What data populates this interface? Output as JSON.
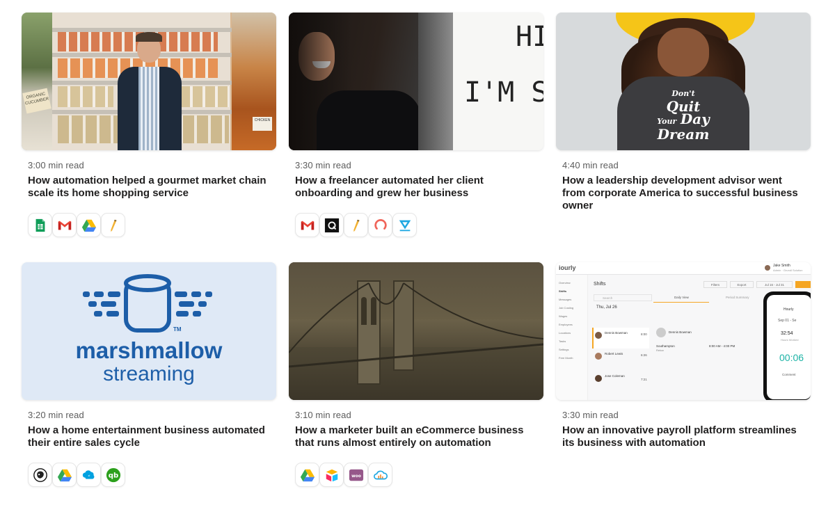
{
  "cards": [
    {
      "read_time": "3:00 min read",
      "title": "How automation helped a gourmet market chain scale its home shopping service",
      "apps": [
        "google-sheets-icon",
        "gmail-icon",
        "google-drive-icon",
        "pencil-app-icon"
      ]
    },
    {
      "read_time": "3:30 min read",
      "title": "How a freelancer automated her client onboarding and grew her business",
      "apps": [
        "gmail-icon",
        "black-box-app-icon",
        "pencil-app-icon",
        "ring-app-icon",
        "blue-v-app-icon"
      ],
      "image_text": [
        "HI,",
        "I'M SH"
      ]
    },
    {
      "read_time": "4:40 min read",
      "title": "How a leadership development advisor went from corporate America to successful business owner",
      "apps": [],
      "image_text": [
        "Don't",
        "Quit",
        "Your",
        "Day",
        "Dream"
      ]
    },
    {
      "read_time": "3:20 min read",
      "title": "How a home entertainment business automated their entire sales cycle",
      "apps": [
        "mailchimp-icon",
        "google-drive-icon",
        "salesforce-icon",
        "quickbooks-icon"
      ],
      "image_text": [
        "marshmallow",
        "streaming",
        "TM"
      ]
    },
    {
      "read_time": "3:10 min read",
      "title": "How a marketer built an eCommerce business that runs almost entirely on automation",
      "apps": [
        "google-drive-icon",
        "airtable-icon",
        "woocommerce-icon",
        "cloud-upload-icon"
      ]
    },
    {
      "read_time": "3:30 min read",
      "title": "How an innovative payroll platform streamlines its business with automation",
      "apps": [],
      "image_text": {
        "brand": "iourly",
        "user": "Jake Smith",
        "user_role": "Admin · Grundl Solution",
        "page_title": "Shifts",
        "filters_btn": "Filters",
        "export_btn": "Export",
        "date_range": "Jul 16 - Jul 31",
        "search_placeholder": "Search",
        "date": "Thu, Jul 26",
        "view_day": "Daily View",
        "view_period": "Period Summary",
        "employees": [
          "Dennis Bowman",
          "Robert Lewis",
          "Jose Coleman"
        ],
        "times": [
          "8:00",
          "6:26",
          "7:21"
        ],
        "shift_name": "Dennis Bowman",
        "shift_location": "Southampton",
        "shift_sub": "Rebar",
        "shift_time": "8:00 AM - 4:00 PM",
        "side_nav": [
          "Overview",
          "Shifts",
          "Messages",
          "Job Costing",
          "Wages",
          "Employees",
          "Locations",
          "Tasks",
          "Settings",
          "Free Month"
        ],
        "phone_title": "Hourly",
        "phone_date": "Sep 01 - Se",
        "phone_time": "32:54",
        "phone_timer": "00:06",
        "phone_status": "Hours Worked",
        "phone_action": "Comment"
      }
    }
  ],
  "colors": {
    "gmail_red": "#ea4335",
    "drive_yellow": "#fbbc04",
    "drive_green": "#34a853",
    "drive_blue": "#4285f4",
    "sheets_green": "#0f9d58",
    "marsh_blue": "#1d5ea8",
    "quickbooks_green": "#2ca01c",
    "salesforce_blue": "#00a1e0",
    "woo_purple": "#96588a",
    "hat_yellow": "#f5c518"
  }
}
